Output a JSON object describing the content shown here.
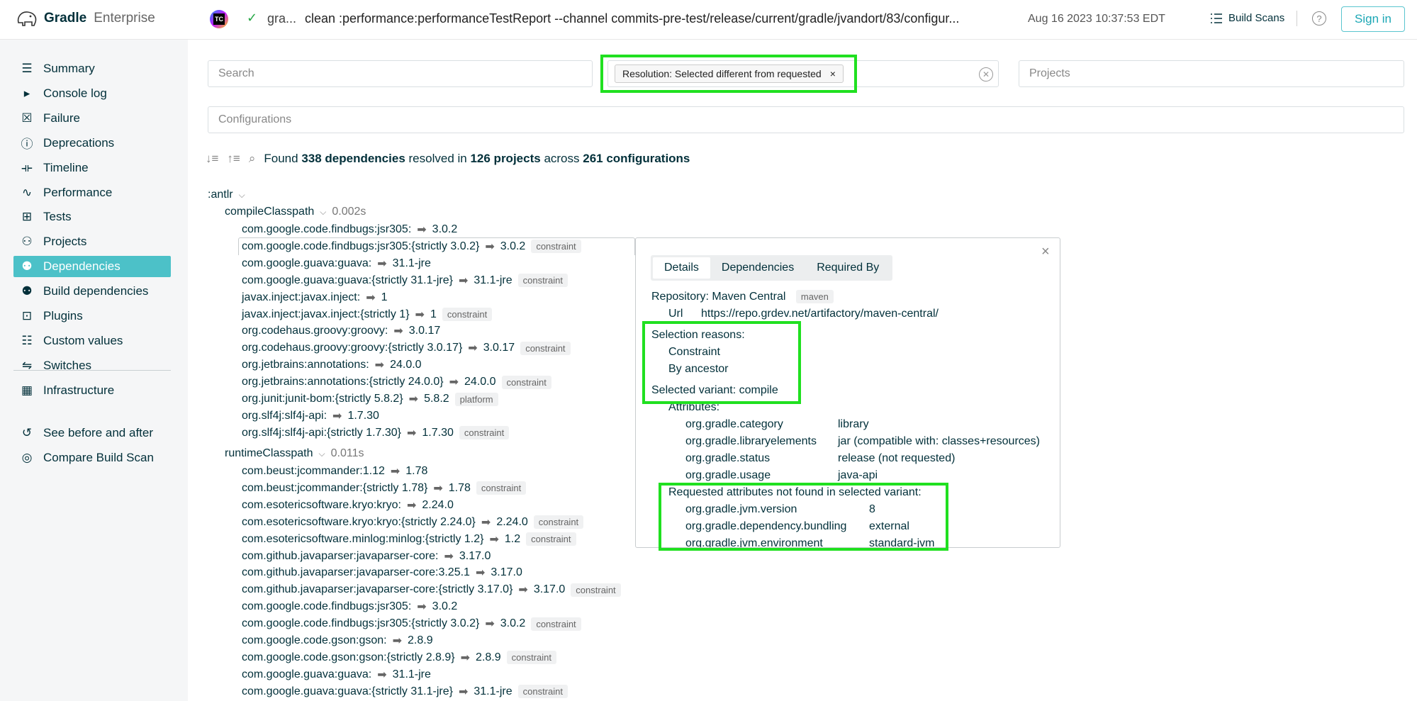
{
  "header": {
    "brand_strong": "Gradle",
    "brand_light": "Enterprise",
    "tc_label": "TC",
    "scan_user": "gra...",
    "scan_command": "clean :performance:performanceTestReport --channel commits-pre-test/release/current/gradle/jvandort/83/configur...",
    "scan_date": "Aug 16 2023 10:37:53 EDT",
    "build_scans_label": "Build Scans",
    "help_label": "?",
    "signin_label": "Sign in"
  },
  "sidebar": {
    "items": [
      {
        "label": "Summary",
        "icon": "summary-icon"
      },
      {
        "label": "Console log",
        "icon": "console-icon"
      },
      {
        "label": "Failure",
        "icon": "failure-icon"
      },
      {
        "label": "Deprecations",
        "icon": "deprecations-icon"
      },
      {
        "label": "Timeline",
        "icon": "timeline-icon"
      },
      {
        "label": "Performance",
        "icon": "performance-icon"
      },
      {
        "label": "Tests",
        "icon": "tests-icon"
      },
      {
        "label": "Projects",
        "icon": "projects-icon"
      },
      {
        "label": "Dependencies",
        "icon": "dependencies-icon"
      },
      {
        "label": "Build dependencies",
        "icon": "build-dependencies-icon"
      },
      {
        "label": "Plugins",
        "icon": "plugins-icon"
      },
      {
        "label": "Custom values",
        "icon": "custom-values-icon"
      },
      {
        "label": "Switches",
        "icon": "switches-icon"
      },
      {
        "label": "Infrastructure",
        "icon": "infrastructure-icon"
      }
    ],
    "footer_items": [
      {
        "label": "See before and after",
        "icon": "history-icon"
      },
      {
        "label": "Compare Build Scan",
        "icon": "compare-icon"
      }
    ],
    "active_color": "#4cc1c8"
  },
  "filters": {
    "search_placeholder": "Search",
    "chip_label": "Resolution: Selected different from requested",
    "chip_remove": "×",
    "projects_placeholder": "Projects",
    "configurations_placeholder": "Configurations"
  },
  "summary": {
    "pre": "Found",
    "dependencies": "338 dependencies",
    "mid1": "resolved in",
    "projects": "126 projects",
    "mid2": "across",
    "configurations": "261 configurations"
  },
  "tree": {
    "project": ":antlr",
    "compile": {
      "name": "compileClasspath",
      "time": "0.002s"
    },
    "compile_rows": [
      {
        "dep": "com.google.code.findbugs:jsr305:",
        "ver": "3.0.2",
        "badge": ""
      },
      {
        "dep": "com.google.code.findbugs:jsr305:{strictly 3.0.2}",
        "ver": "3.0.2",
        "badge": "constraint"
      },
      {
        "dep": "com.google.guava:guava:",
        "ver": "31.1-jre",
        "badge": ""
      },
      {
        "dep": "com.google.guava:guava:{strictly 31.1-jre}",
        "ver": "31.1-jre",
        "badge": "constraint"
      },
      {
        "dep": "javax.inject:javax.inject:",
        "ver": "1",
        "badge": ""
      },
      {
        "dep": "javax.inject:javax.inject:{strictly 1}",
        "ver": "1",
        "badge": "constraint"
      },
      {
        "dep": "org.codehaus.groovy:groovy:",
        "ver": "3.0.17",
        "badge": ""
      },
      {
        "dep": "org.codehaus.groovy:groovy:{strictly 3.0.17}",
        "ver": "3.0.17",
        "badge": "constraint"
      },
      {
        "dep": "org.jetbrains:annotations:",
        "ver": "24.0.0",
        "badge": ""
      },
      {
        "dep": "org.jetbrains:annotations:{strictly 24.0.0}",
        "ver": "24.0.0",
        "badge": "constraint"
      },
      {
        "dep": "org.junit:junit-bom:{strictly 5.8.2}",
        "ver": "5.8.2",
        "badge": "platform"
      },
      {
        "dep": "org.slf4j:slf4j-api:",
        "ver": "1.7.30",
        "badge": ""
      },
      {
        "dep": "org.slf4j:slf4j-api:{strictly 1.7.30}",
        "ver": "1.7.30",
        "badge": "constraint"
      }
    ],
    "runtime": {
      "name": "runtimeClasspath",
      "time": "0.011s"
    },
    "runtime_rows": [
      {
        "dep": "com.beust:jcommander:1.12",
        "ver": "1.78",
        "badge": ""
      },
      {
        "dep": "com.beust:jcommander:{strictly 1.78}",
        "ver": "1.78",
        "badge": "constraint"
      },
      {
        "dep": "com.esotericsoftware.kryo:kryo:",
        "ver": "2.24.0",
        "badge": ""
      },
      {
        "dep": "com.esotericsoftware.kryo:kryo:{strictly 2.24.0}",
        "ver": "2.24.0",
        "badge": "constraint"
      },
      {
        "dep": "com.esotericsoftware.minlog:minlog:{strictly 1.2}",
        "ver": "1.2",
        "badge": "constraint"
      },
      {
        "dep": "com.github.javaparser:javaparser-core:",
        "ver": "3.17.0",
        "badge": ""
      },
      {
        "dep": "com.github.javaparser:javaparser-core:3.25.1",
        "ver": "3.17.0",
        "badge": ""
      },
      {
        "dep": "com.github.javaparser:javaparser-core:{strictly 3.17.0}",
        "ver": "3.17.0",
        "badge": "constraint"
      },
      {
        "dep": "com.google.code.findbugs:jsr305:",
        "ver": "3.0.2",
        "badge": ""
      },
      {
        "dep": "com.google.code.findbugs:jsr305:{strictly 3.0.2}",
        "ver": "3.0.2",
        "badge": "constraint"
      },
      {
        "dep": "com.google.code.gson:gson:",
        "ver": "2.8.9",
        "badge": ""
      },
      {
        "dep": "com.google.code.gson:gson:{strictly 2.8.9}",
        "ver": "2.8.9",
        "badge": "constraint"
      },
      {
        "dep": "com.google.guava:guava:",
        "ver": "31.1-jre",
        "badge": ""
      },
      {
        "dep": "com.google.guava:guava:{strictly 31.1-jre}",
        "ver": "31.1-jre",
        "badge": "constraint"
      }
    ]
  },
  "panel": {
    "tabs": [
      "Details",
      "Dependencies",
      "Required By"
    ],
    "repository_label": "Repository: Maven Central",
    "repository_badge": "maven",
    "url_label": "Url",
    "url_value": "https://repo.grdev.net/artifactory/maven-central/",
    "selection_reasons_label": "Selection reasons:",
    "reasons": [
      "Constraint",
      "By ancestor"
    ],
    "selected_variant": "Selected variant: compile",
    "attributes_label": "Attributes:",
    "attributes": [
      {
        "k": "org.gradle.category",
        "v": "library"
      },
      {
        "k": "org.gradle.libraryelements",
        "v": "jar (compatible with: classes+resources)"
      },
      {
        "k": "org.gradle.status",
        "v": "release (not requested)"
      },
      {
        "k": "org.gradle.usage",
        "v": "java-api"
      }
    ],
    "requested_label": "Requested attributes not found in selected variant:",
    "requested": [
      {
        "k": "org.gradle.jvm.version",
        "v": "8"
      },
      {
        "k": "org.gradle.dependency.bundling",
        "v": "external"
      },
      {
        "k": "org.gradle.jvm.environment",
        "v": "standard-jvm"
      }
    ],
    "close_label": "×"
  },
  "colors": {
    "highlight": "#20e020",
    "accent": "#4cc1c8",
    "text": "#02303a"
  }
}
